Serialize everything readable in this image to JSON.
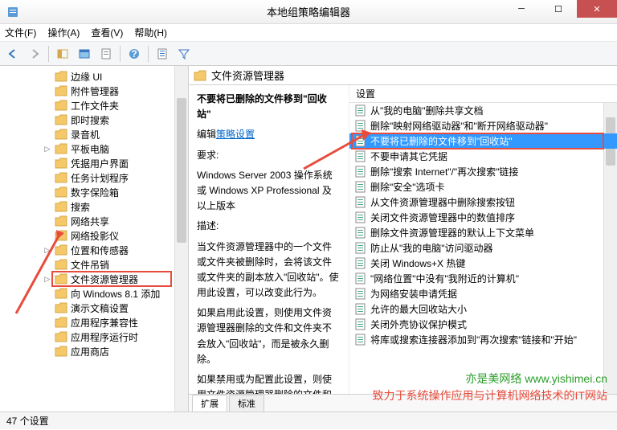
{
  "window": {
    "title": "本地组策略编辑器"
  },
  "menu": {
    "file": "文件(F)",
    "action": "操作(A)",
    "view": "查看(V)",
    "help": "帮助(H)"
  },
  "tree": {
    "items": [
      {
        "label": "边缘 UI"
      },
      {
        "label": "附件管理器"
      },
      {
        "label": "工作文件夹"
      },
      {
        "label": "即时搜索"
      },
      {
        "label": "录音机"
      },
      {
        "label": "平板电脑",
        "exp": true
      },
      {
        "label": "凭据用户界面"
      },
      {
        "label": "任务计划程序"
      },
      {
        "label": "数字保险箱"
      },
      {
        "label": "搜索"
      },
      {
        "label": "网络共享"
      },
      {
        "label": "网络投影仪"
      },
      {
        "label": "位置和传感器",
        "exp": true
      },
      {
        "label": "文件吊销"
      },
      {
        "label": "文件资源管理器",
        "exp": true,
        "sel": true
      },
      {
        "label": "向 Windows 8.1 添加"
      },
      {
        "label": "演示文稿设置"
      },
      {
        "label": "应用程序兼容性"
      },
      {
        "label": "应用程序运行时"
      },
      {
        "label": "应用商店"
      }
    ]
  },
  "detail": {
    "heading": "文件资源管理器",
    "title": "不要将已删除的文件移到\"回收站\"",
    "edit_prefix": "编辑",
    "edit_link": "策略设置",
    "req_label": "要求:",
    "req_text": "Windows Server 2003 操作系统或 Windows XP Professional 及以上版本",
    "desc_label": "描述:",
    "desc1": "当文件资源管理器中的一个文件或文件夹被删除时，会将该文件或文件夹的副本放入\"回收站\"。使用此设置，可以改变此行为。",
    "desc2": "如果启用此设置，则使用文件资源管理器删除的文件和文件夹不会放入\"回收站\"，而是被永久删除。",
    "desc3": "如果禁用或为配置此设置，则使用文件资源管理器删除的文件和文件"
  },
  "column": "设置",
  "settings": [
    "从\"我的电脑\"删除共享文档",
    "删除\"映射网络驱动器\"和\"断开网络驱动器\"",
    "不要将已删除的文件移到\"回收站\"",
    "不要申请其它凭据",
    "删除\"搜索 Internet\"/\"再次搜索\"链接",
    "删除\"安全\"选项卡",
    "从文件资源管理器中删除搜索按钮",
    "关闭文件资源管理器中的数值排序",
    "删除文件资源管理器的默认上下文菜单",
    "防止从\"我的电脑\"访问驱动器",
    "关闭 Windows+X 热键",
    "\"网络位置\"中没有\"我附近的计算机\"",
    "为网络安装申请凭据",
    "允许的最大回收站大小",
    "关闭外壳协议保护模式",
    "将库或搜索连接器添加到\"再次搜索\"链接和\"开始\""
  ],
  "selectedIndex": 2,
  "tabs": {
    "ext": "扩展",
    "std": "标准"
  },
  "status": "47 个设置",
  "watermark": {
    "l1": "亦是美网络 www.yishimei.cn",
    "l2": "致力于系统操作应用与计算机网络技术的IT网站"
  }
}
